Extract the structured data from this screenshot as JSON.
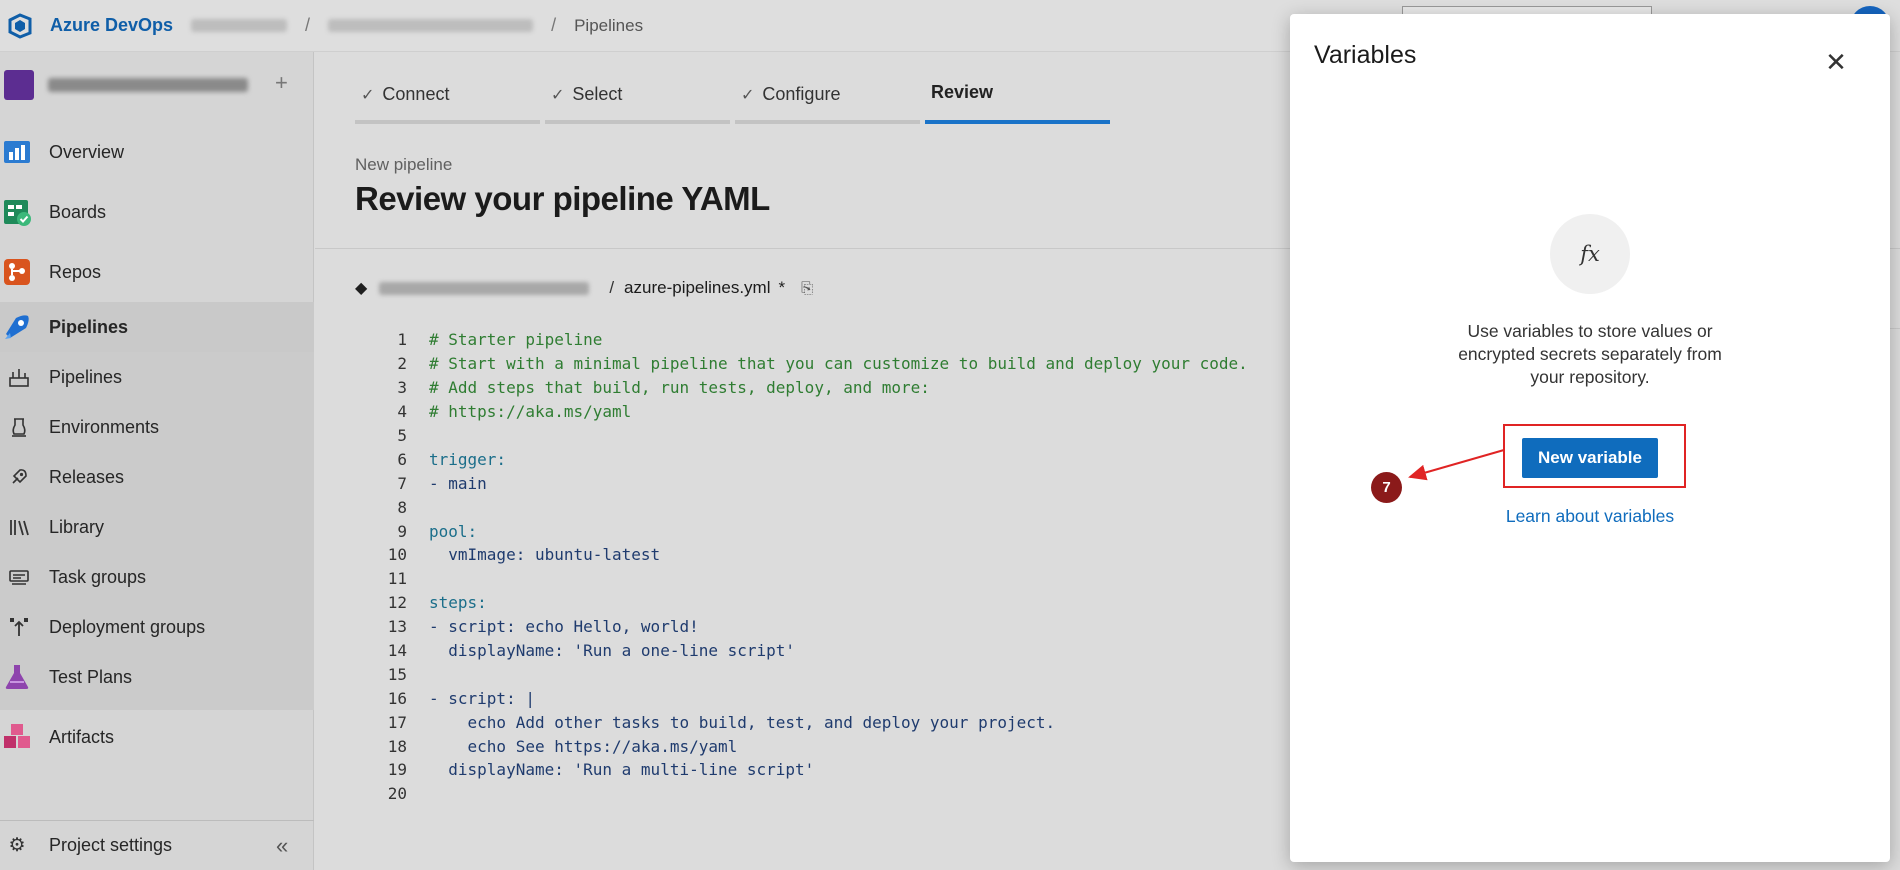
{
  "topbar": {
    "brand": "Azure DevOps",
    "breadcrumb_last": "Pipelines",
    "brand_color": "#0f5ea8"
  },
  "sidebar": {
    "items": [
      {
        "label": "Overview",
        "icon": "overview-icon"
      },
      {
        "label": "Boards",
        "icon": "boards-icon"
      },
      {
        "label": "Repos",
        "icon": "repos-icon"
      },
      {
        "label": "Pipelines",
        "icon": "pipelines-icon",
        "active": true
      },
      {
        "label": "Pipelines",
        "icon": "pipelines-sub-icon"
      },
      {
        "label": "Environments",
        "icon": "environments-icon"
      },
      {
        "label": "Releases",
        "icon": "releases-icon"
      },
      {
        "label": "Library",
        "icon": "library-icon"
      },
      {
        "label": "Task groups",
        "icon": "task-groups-icon"
      },
      {
        "label": "Deployment groups",
        "icon": "deployment-groups-icon"
      },
      {
        "label": "Test Plans",
        "icon": "test-plans-icon"
      },
      {
        "label": "Artifacts",
        "icon": "artifacts-icon"
      }
    ],
    "footer_label": "Project settings"
  },
  "wizard": {
    "steps": [
      {
        "label": "Connect",
        "done": true
      },
      {
        "label": "Select",
        "done": true
      },
      {
        "label": "Configure",
        "done": true
      },
      {
        "label": "Review",
        "done": false,
        "active": true
      }
    ]
  },
  "header": {
    "subtitle": "New pipeline",
    "title": "Review your pipeline YAML"
  },
  "file": {
    "separator": "/",
    "name": "azure-pipelines.yml",
    "dirty": "*"
  },
  "editor": {
    "lines": [
      {
        "n": "1",
        "text": "# Starter pipeline",
        "kind": "comment"
      },
      {
        "n": "2",
        "text": "# Start with a minimal pipeline that you can customize to build and deploy your code.",
        "kind": "comment"
      },
      {
        "n": "3",
        "text": "# Add steps that build, run tests, deploy, and more:",
        "kind": "comment"
      },
      {
        "n": "4",
        "text": "# https://aka.ms/yaml",
        "kind": "comment"
      },
      {
        "n": "5",
        "text": "",
        "kind": "code"
      },
      {
        "n": "6",
        "text": "trigger:",
        "kind": "key"
      },
      {
        "n": "7",
        "text": "- main",
        "kind": "code"
      },
      {
        "n": "8",
        "text": "",
        "kind": "code"
      },
      {
        "n": "9",
        "text": "pool:",
        "kind": "key"
      },
      {
        "n": "10",
        "text": "  vmImage: ubuntu-latest",
        "kind": "code"
      },
      {
        "n": "11",
        "text": "",
        "kind": "code"
      },
      {
        "n": "12",
        "text": "steps:",
        "kind": "key"
      },
      {
        "n": "13",
        "text": "- script: echo Hello, world!",
        "kind": "code"
      },
      {
        "n": "14",
        "text": "  displayName: 'Run a one-line script'",
        "kind": "code"
      },
      {
        "n": "15",
        "text": "",
        "kind": "code"
      },
      {
        "n": "16",
        "text": "- script: |",
        "kind": "code"
      },
      {
        "n": "17",
        "text": "    echo Add other tasks to build, test, and deploy your project.",
        "kind": "code"
      },
      {
        "n": "18",
        "text": "    echo See https://aka.ms/yaml",
        "kind": "code"
      },
      {
        "n": "19",
        "text": "  displayName: 'Run a multi-line script'",
        "kind": "code"
      },
      {
        "n": "20",
        "text": "",
        "kind": "code"
      }
    ]
  },
  "panel": {
    "title": "Variables",
    "close_glyph": "✕",
    "fx_glyph": "fx",
    "description": "Use variables to store values or encrypted secrets separately from your repository.",
    "new_variable_label": "New variable",
    "learn_link": "Learn about variables",
    "accent_color": "#0f6cbd"
  },
  "annotation": {
    "step_number": "7",
    "highlight_color": "#e02424",
    "badge_color": "#8b1a1a"
  }
}
